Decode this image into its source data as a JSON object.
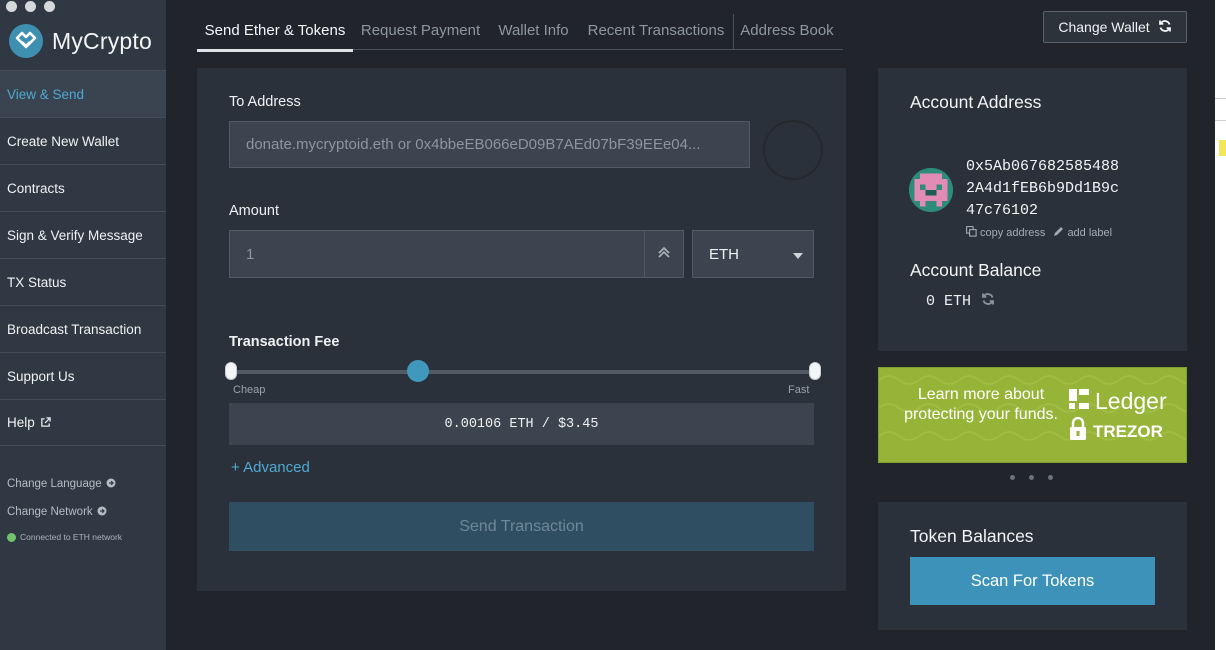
{
  "app": {
    "name": "MyCrypto"
  },
  "sidebar": {
    "items": [
      {
        "label": "View & Send",
        "active": true
      },
      {
        "label": "Create New Wallet"
      },
      {
        "label": "Contracts"
      },
      {
        "label": "Sign & Verify Message"
      },
      {
        "label": "TX Status"
      },
      {
        "label": "Broadcast Transaction"
      },
      {
        "label": "Support Us"
      },
      {
        "label": "Help"
      }
    ],
    "change_language": "Change Language",
    "change_network": "Change Network",
    "network_status": "Connected to ETH network"
  },
  "tabs": [
    {
      "label": "Send Ether & Tokens",
      "active": true
    },
    {
      "label": "Request Payment"
    },
    {
      "label": "Wallet Info"
    },
    {
      "label": "Recent Transactions"
    },
    {
      "label": "Address Book"
    }
  ],
  "header": {
    "change_wallet_label": "Change Wallet"
  },
  "send": {
    "to_address_label": "To Address",
    "to_address_placeholder": "donate.mycryptoid.eth or 0x4bbeEB066eD09B7AEd07bF39EEe04...",
    "amount_label": "Amount",
    "amount_placeholder": "1",
    "unit": "ETH",
    "fee_label": "Transaction Fee",
    "fee_cheap": "Cheap",
    "fee_fast": "Fast",
    "fee_level": 0.32,
    "fee_value": "0.00106 ETH / $3.45",
    "advanced_label": "+ Advanced",
    "send_label": "Send Transaction"
  },
  "account": {
    "address_title": "Account Address",
    "address_lines": [
      "0x5Ab067682585488",
      "2A4d1fEB6b9Dd1B9c",
      "47c76102"
    ],
    "copy_label": "copy address",
    "add_label": "add label",
    "balance_title": "Account Balance",
    "balance": "0 ETH"
  },
  "promo": {
    "text": "Learn more about protecting your funds.",
    "brand_1": "Ledger",
    "brand_2": "TREZOR"
  },
  "tokens": {
    "title": "Token Balances",
    "scan_label": "Scan For Tokens"
  },
  "colors": {
    "accent": "#4ea9d2",
    "button_blue": "#3d92b9",
    "promo_green": "#96b538",
    "status_green": "#6fc36f"
  }
}
